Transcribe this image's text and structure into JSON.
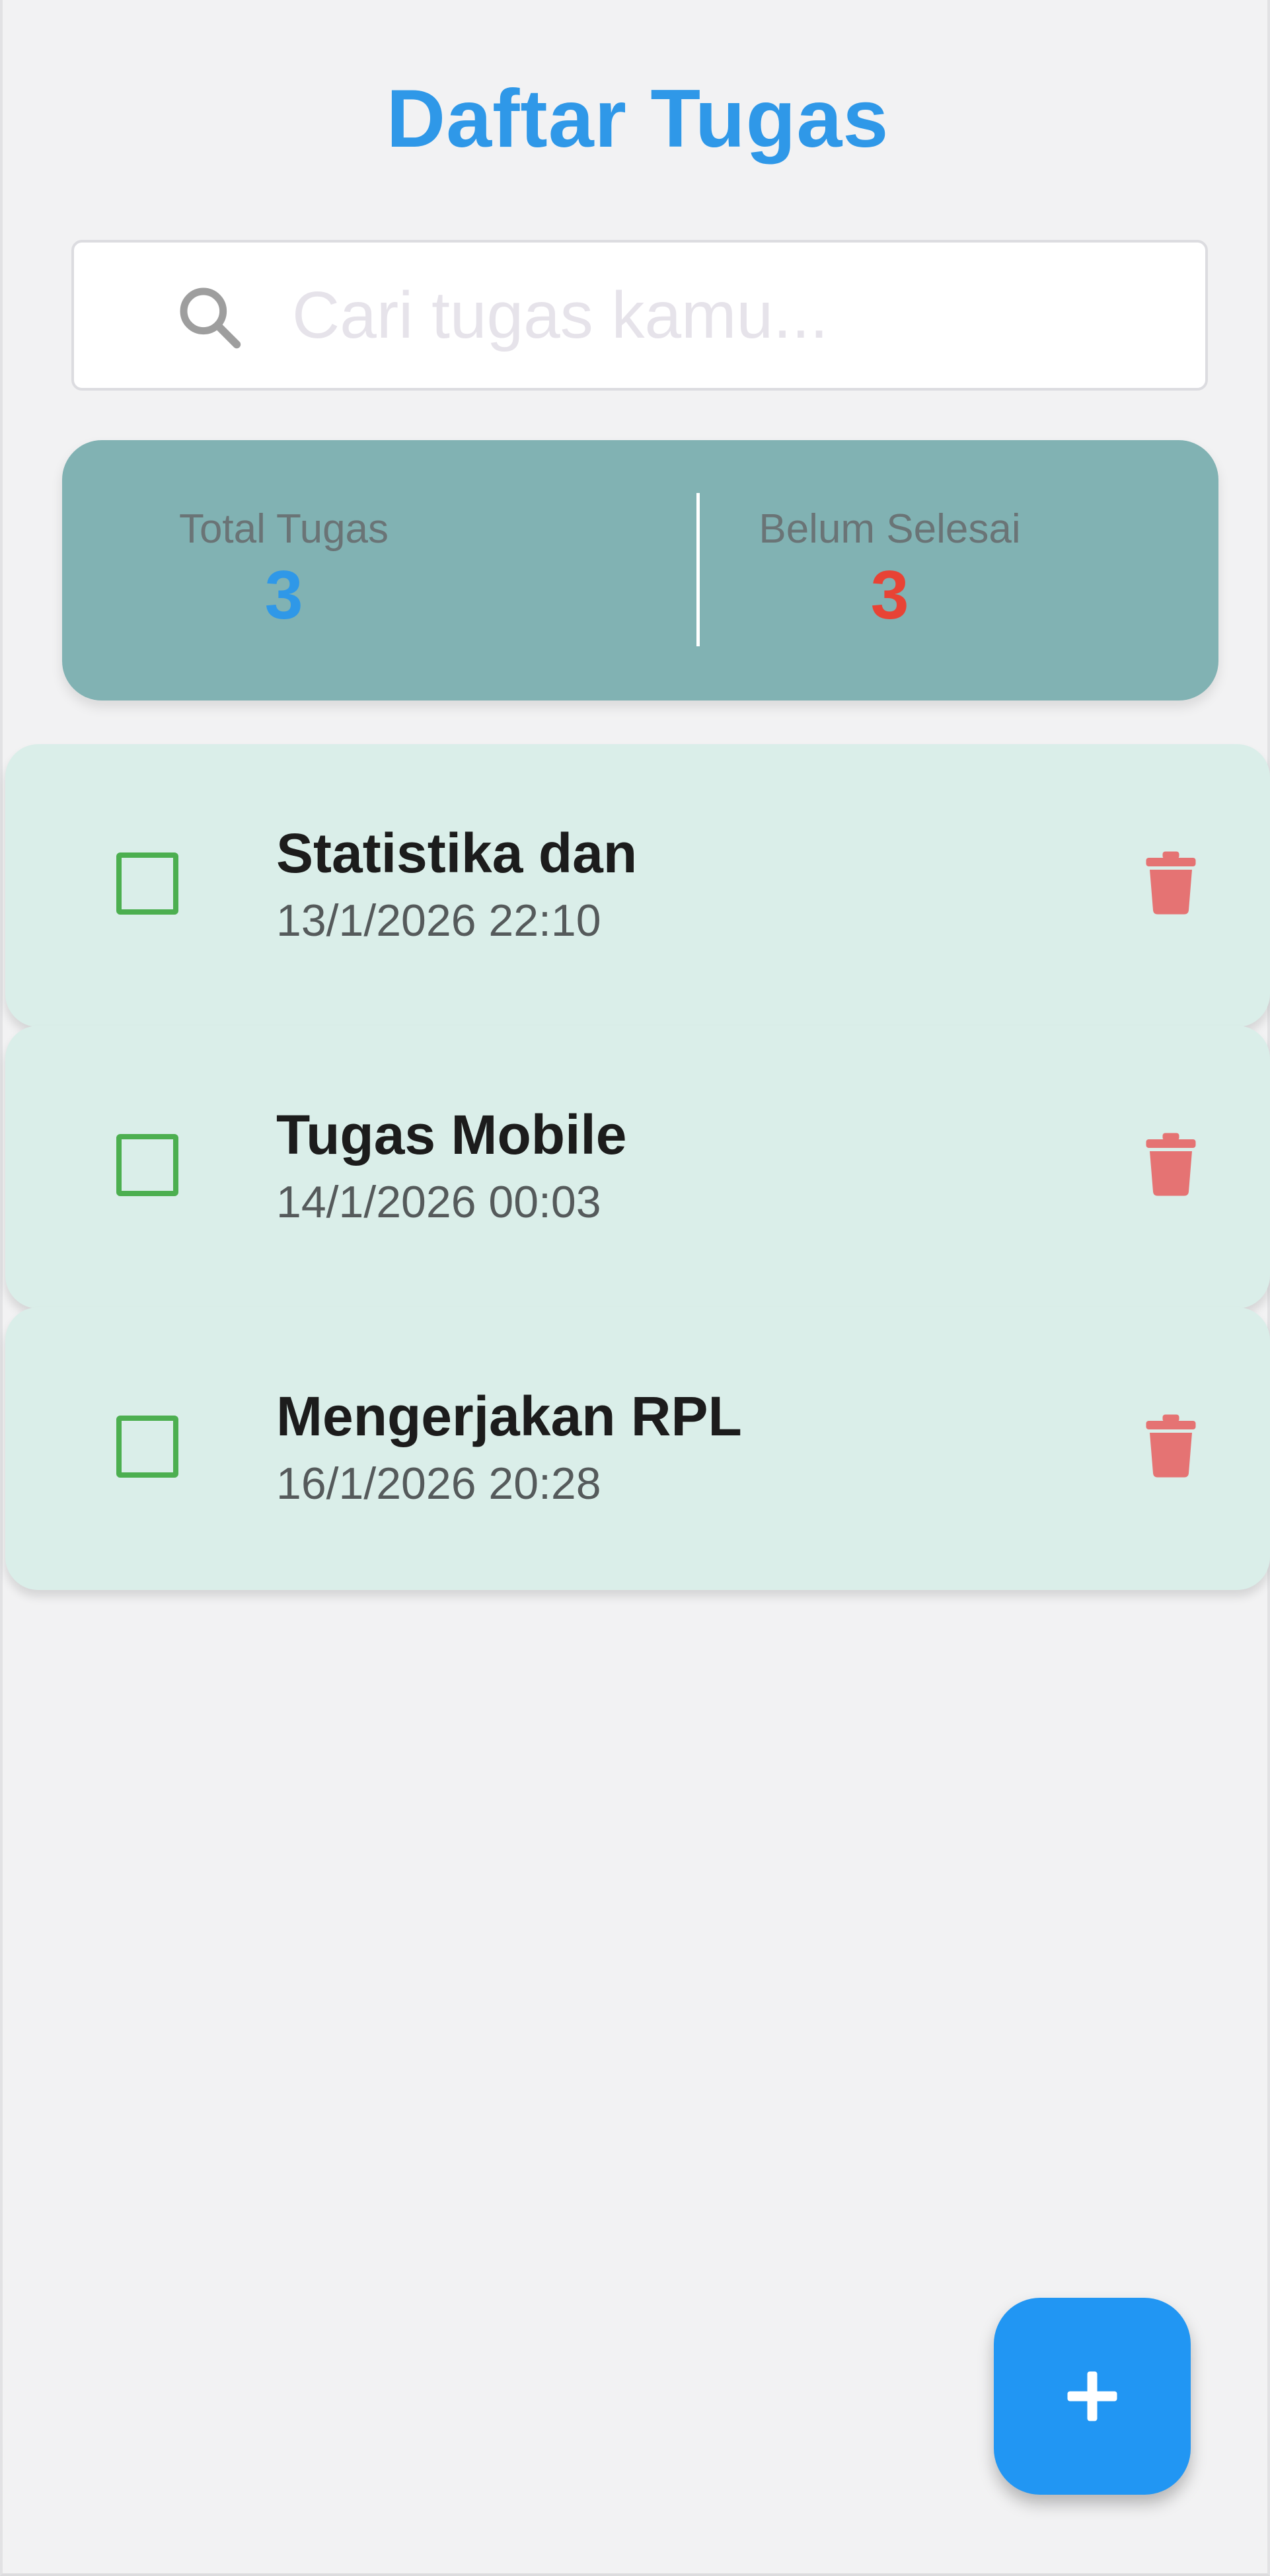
{
  "header": {
    "title": "Daftar Tugas"
  },
  "search": {
    "placeholder": "Cari tugas kamu...",
    "value": "",
    "icon": "search-icon"
  },
  "stats": {
    "total_label": "Total Tugas",
    "total_value": "3",
    "pending_label": "Belum Selesai",
    "pending_value": "3"
  },
  "tasks": [
    {
      "title": "Statistika dan",
      "date": "13/1/2026 22:10",
      "completed": false
    },
    {
      "title": "Tugas Mobile",
      "date": "14/1/2026 00:03",
      "completed": false
    },
    {
      "title": "Mengerjakan RPL",
      "date": "16/1/2026 20:28",
      "completed": false
    }
  ],
  "fab": {
    "icon": "plus-icon"
  },
  "colors": {
    "accent": "#2196f3",
    "title": "#2f98e8",
    "pending": "#e84335",
    "checkbox": "#4caf50",
    "delete": "#e57373",
    "stats_card": "#81b2b3",
    "task_card": "#daeee9"
  }
}
